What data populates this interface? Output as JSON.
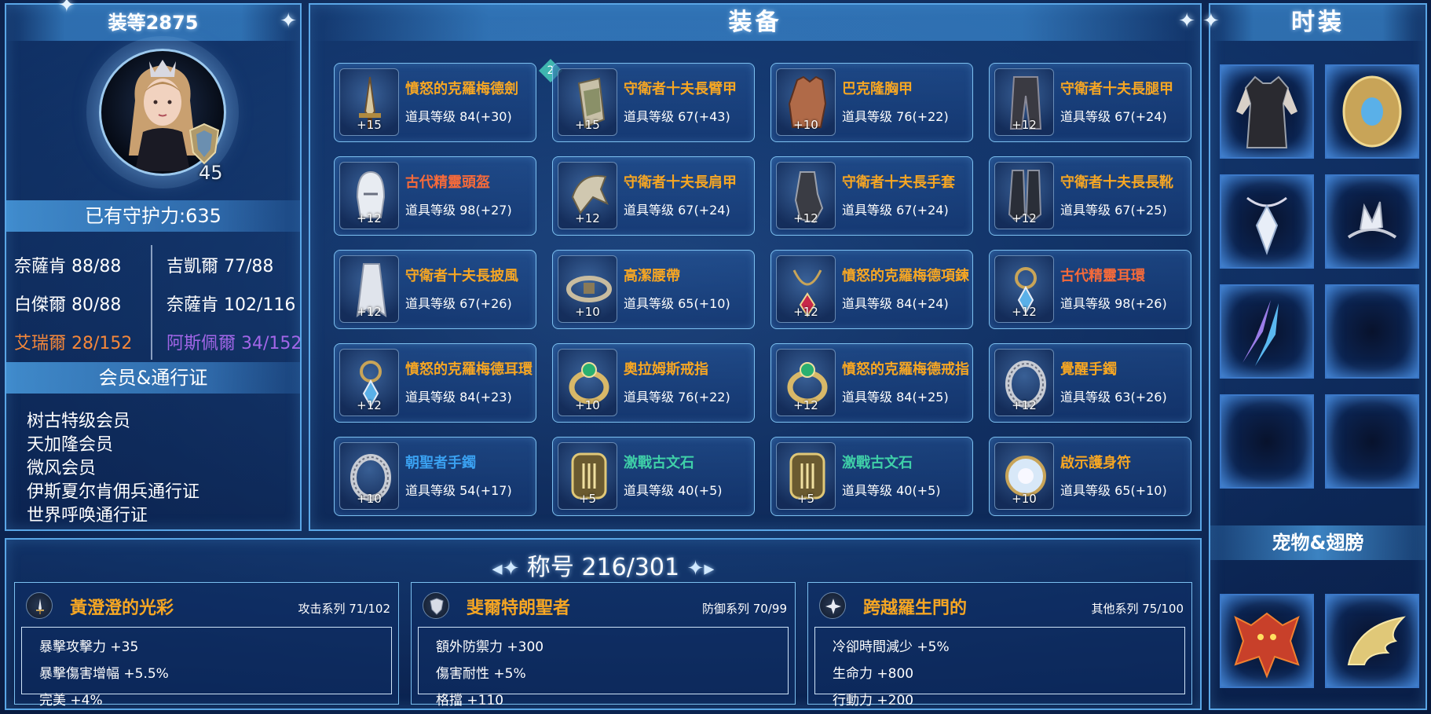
{
  "left": {
    "gear_score": "装等2875",
    "level": "45",
    "guard_power": "已有守护力:635",
    "stats": [
      {
        "label": "奈薩肯 88/88",
        "color": "#ffffff"
      },
      {
        "label": "吉凱爾 77/88",
        "color": "#ffffff"
      },
      {
        "label": "白傑爾 80/88",
        "color": "#ffffff"
      },
      {
        "label": "奈薩肯 102/116",
        "color": "#ffffff"
      },
      {
        "label": "艾瑞爾 28/152",
        "color": "#f5873a"
      },
      {
        "label": "阿斯佩爾 34/152",
        "color": "#a266e8"
      }
    ],
    "membership_header": "会员&通行证",
    "memberships": [
      "树古特级会员",
      "天加隆会员",
      "微风会员",
      "伊斯夏尔肯佣兵通行证",
      "世界呼唤通行证"
    ]
  },
  "equipment": {
    "title": "装备",
    "badge": "2",
    "items": [
      {
        "name": "憤怒的克羅梅德劍",
        "level": "道具等级 84(+30)",
        "plus": "+15",
        "color": "#f6a623",
        "icon": "sword-icon"
      },
      {
        "name": "守衛者十夫長臂甲",
        "level": "道具等级 67(+43)",
        "plus": "+15",
        "color": "#f6a623",
        "icon": "bracer-icon"
      },
      {
        "name": "巴克隆胸甲",
        "level": "道具等级 76(+22)",
        "plus": "+10",
        "color": "#f6a623",
        "icon": "chestplate-icon"
      },
      {
        "name": "守衛者十夫長腿甲",
        "level": "道具等级 67(+24)",
        "plus": "+12",
        "color": "#f6a623",
        "icon": "leggings-icon"
      },
      {
        "name": "古代精靈頭盔",
        "level": "道具等级 98(+27)",
        "plus": "+12",
        "color": "#f56a3a",
        "icon": "helmet-icon"
      },
      {
        "name": "守衛者十夫長肩甲",
        "level": "道具等级 67(+24)",
        "plus": "+12",
        "color": "#f6a623",
        "icon": "shoulder-icon"
      },
      {
        "name": "守衛者十夫長手套",
        "level": "道具等级 67(+24)",
        "plus": "+12",
        "color": "#f6a623",
        "icon": "gloves-icon"
      },
      {
        "name": "守衛者十夫長長靴",
        "level": "道具等级 67(+25)",
        "plus": "+12",
        "color": "#f6a623",
        "icon": "boots-icon"
      },
      {
        "name": "守衛者十夫長披風",
        "level": "道具等级 67(+26)",
        "plus": "+12",
        "color": "#f6a623",
        "icon": "cape-icon"
      },
      {
        "name": "高潔腰帶",
        "level": "道具等级 65(+10)",
        "plus": "+10",
        "color": "#f6a623",
        "icon": "belt-icon"
      },
      {
        "name": "憤怒的克羅梅德項鍊",
        "level": "道具等级 84(+24)",
        "plus": "+12",
        "color": "#f6a623",
        "icon": "necklace-icon"
      },
      {
        "name": "古代精靈耳環",
        "level": "道具等级 98(+26)",
        "plus": "+12",
        "color": "#f56a3a",
        "icon": "earring-icon"
      },
      {
        "name": "憤怒的克羅梅德耳環",
        "level": "道具等级 84(+23)",
        "plus": "+12",
        "color": "#f6a623",
        "icon": "earring-icon"
      },
      {
        "name": "奧拉姆斯戒指",
        "level": "道具等级 76(+22)",
        "plus": "+10",
        "color": "#f6a623",
        "icon": "ring-icon"
      },
      {
        "name": "憤怒的克羅梅德戒指",
        "level": "道具等级 84(+25)",
        "plus": "+12",
        "color": "#f6a623",
        "icon": "ring-icon"
      },
      {
        "name": "覺醒手鐲",
        "level": "道具等级 63(+26)",
        "plus": "+12",
        "color": "#f6a623",
        "icon": "bracelet-icon"
      },
      {
        "name": "朝聖者手鐲",
        "level": "道具等级 54(+17)",
        "plus": "+10",
        "color": "#3aa0f0",
        "icon": "bracelet-icon"
      },
      {
        "name": "激戰古文石",
        "level": "道具等级 40(+5)",
        "plus": "+5",
        "color": "#3fd0a8",
        "icon": "stone-icon"
      },
      {
        "name": "激戰古文石",
        "level": "道具等级 40(+5)",
        "plus": "+5",
        "color": "#3fd0a8",
        "icon": "stone-icon"
      },
      {
        "name": "啟示護身符",
        "level": "道具等级 65(+10)",
        "plus": "+10",
        "color": "#f6a623",
        "icon": "amulet-icon"
      }
    ]
  },
  "fashion": {
    "title": "时装",
    "slots": [
      "outfit-icon",
      "shield-icon",
      "pendant-icon",
      "tiara-icon",
      "wings-earring-icon",
      "",
      "",
      ""
    ],
    "pet_header": "宠物&翅膀",
    "pets": [
      "dragon-pet-icon",
      "golden-wings-icon"
    ]
  },
  "titles": {
    "heading": "称号 216/301",
    "cards": [
      {
        "name": "黃澄澄的光彩",
        "series": "攻击系列 71/102",
        "icon": "sword-icon",
        "stats": [
          "暴擊攻擊力 +35",
          "暴擊傷害增幅 +5.5%",
          "完美 +4%"
        ]
      },
      {
        "name": "斐爾特朗聖者",
        "series": "防御系列 70/99",
        "icon": "shield-icon",
        "stats": [
          "額外防禦力 +300",
          "傷害耐性 +5%",
          "格擋 +110"
        ]
      },
      {
        "name": "跨越羅生門的",
        "series": "其他系列 75/100",
        "icon": "star-icon",
        "stats": [
          "冷卻時間減少 +5%",
          "生命力 +800",
          "行動力 +200"
        ]
      }
    ]
  }
}
